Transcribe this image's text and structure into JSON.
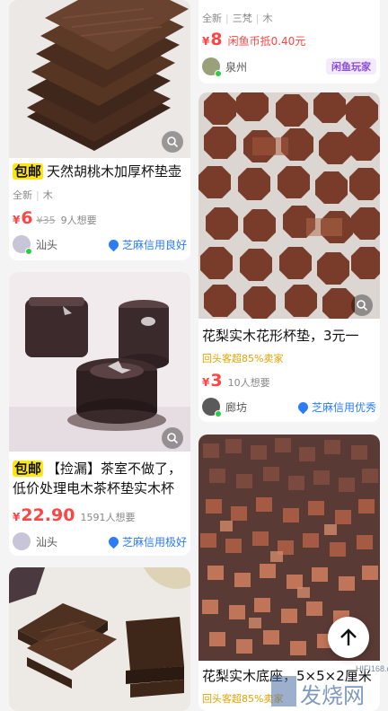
{
  "colors": {
    "price_red": "#ff4444",
    "baoyou_yellow": "#ffe60f",
    "zhima_blue": "#2b7cf6",
    "xianyu_purple": "#8a4dd6",
    "hint_orange": "#e0a300"
  },
  "left": {
    "card1": {
      "badge": "包邮",
      "title": "天然胡桃木加厚杯垫壶",
      "tags": [
        "全新",
        "木"
      ],
      "yen": "¥",
      "price": "6",
      "old_price": "¥35",
      "want": "9人想要",
      "city": "汕头",
      "credit": "芝麻信用良好"
    },
    "card2": {
      "badge": "包邮",
      "title": "【捡漏】茶室不做了，低价处理电木茶杯垫实木杯",
      "yen": "¥",
      "price": "22.90",
      "want": "1591人想要",
      "city": "汕头",
      "credit": "芝麻信用极好"
    }
  },
  "right": {
    "card0": {
      "tags": [
        "全新",
        "三梵",
        "木"
      ],
      "yen": "¥",
      "price": "8",
      "coin": "闲鱼币抵0.40元",
      "city": "泉州",
      "xianyu_badge": "闲鱼玩家"
    },
    "card1": {
      "title": "花梨实木花形杯垫，3元一",
      "hint": "回头客超85%卖家",
      "yen": "¥",
      "price": "3",
      "want": "10人想要",
      "city": "廊坊",
      "credit": "芝麻信用优秀"
    },
    "card2": {
      "title": "花梨实木底座，5×5×2厘米",
      "hint": "回头客超85%卖家"
    }
  },
  "icons": {
    "scan": "scan-icon",
    "up": "arrow-up-icon",
    "credit": "zhima-credit-icon"
  },
  "watermark": {
    "text": "发烧网",
    "sub": "HIFI168.com"
  }
}
